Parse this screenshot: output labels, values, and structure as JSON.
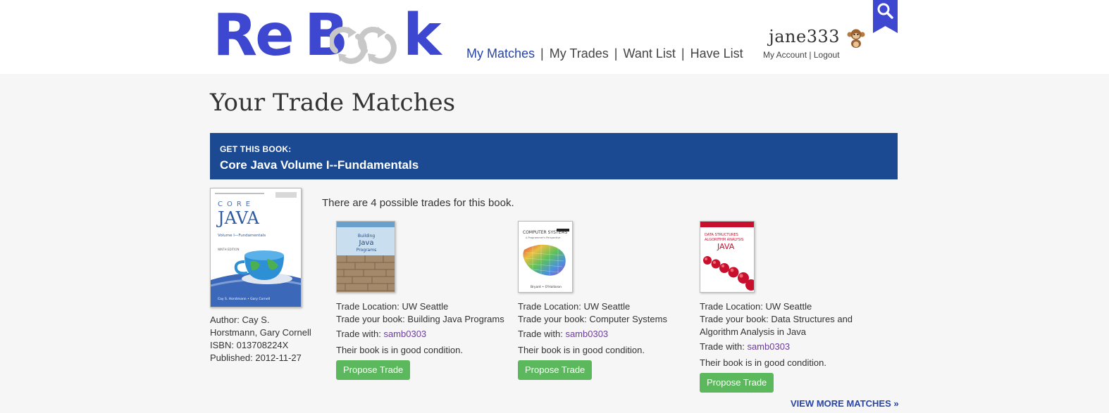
{
  "header": {
    "logo_letters": {
      "re": "Re",
      "b": "B",
      "k": "k"
    },
    "logo_text": "ReBook",
    "nav": [
      {
        "label": "My Matches",
        "active": true
      },
      {
        "label": "My Trades",
        "active": false
      },
      {
        "label": "Want List",
        "active": false
      },
      {
        "label": "Have List",
        "active": false
      }
    ],
    "nav_separator": "|",
    "username": "jane333",
    "account": {
      "my_account": "My Account",
      "separator": "|",
      "logout": "Logout"
    },
    "avatar_icon": "monkey-avatar-icon",
    "search_icon": "search-icon"
  },
  "main": {
    "title": "Your Trade Matches",
    "banner": {
      "label": "GET THIS BOOK:",
      "title": "Core Java Volume I--Fundamentals"
    },
    "book": {
      "cover_title_line1": "CORE",
      "cover_title_line2": "JAVA",
      "cover_subtitle": "Volume I—Fundamentals",
      "cover_edition": "NINTH EDITION",
      "cover_authors": "Cay S. Horstmann • Gary Cornell",
      "author_label": "Author:",
      "author": "Cay S. Horstmann, Gary Cornell",
      "isbn_label": "ISBN:",
      "isbn": "013708224X",
      "published_label": "Published:",
      "published": "2012-11-27"
    },
    "trades_count_text": "There are 4 possible trades for this book.",
    "trades": [
      {
        "cover_title": "Building Java Programs",
        "location_label": "Trade Location:",
        "location": "UW Seattle",
        "your_book_label": "Trade your book:",
        "your_book": "Building Java Programs",
        "with_label": "Trade with:",
        "with_user": "samb0303",
        "condition": "Their book is in good condition.",
        "button": "Propose Trade"
      },
      {
        "cover_title": "Computer Systems",
        "location_label": "Trade Location:",
        "location": "UW Seattle",
        "your_book_label": "Trade your book:",
        "your_book": "Computer Systems",
        "with_label": "Trade with:",
        "with_user": "samb0303",
        "condition": "Their book is in good condition.",
        "button": "Propose Trade"
      },
      {
        "cover_title": "Data Structures and Algorithm Analysis in Java",
        "location_label": "Trade Location:",
        "location": "UW Seattle",
        "your_book_label": "Trade your book:",
        "your_book": "Data Structures and Algorithm Analysis in Java",
        "with_label": "Trade with:",
        "with_user": "samb0303",
        "condition": "Their book is in good condition.",
        "button": "Propose Trade"
      }
    ],
    "view_more": "VIEW MORE MATCHES »"
  },
  "colors": {
    "brand_blue": "#3d47cf",
    "banner_blue": "#1b4a93",
    "nav_active": "#2845a8",
    "button_green": "#5cb85c",
    "link_purple": "#6a3d9a",
    "page_bg": "#f6f6f6"
  }
}
